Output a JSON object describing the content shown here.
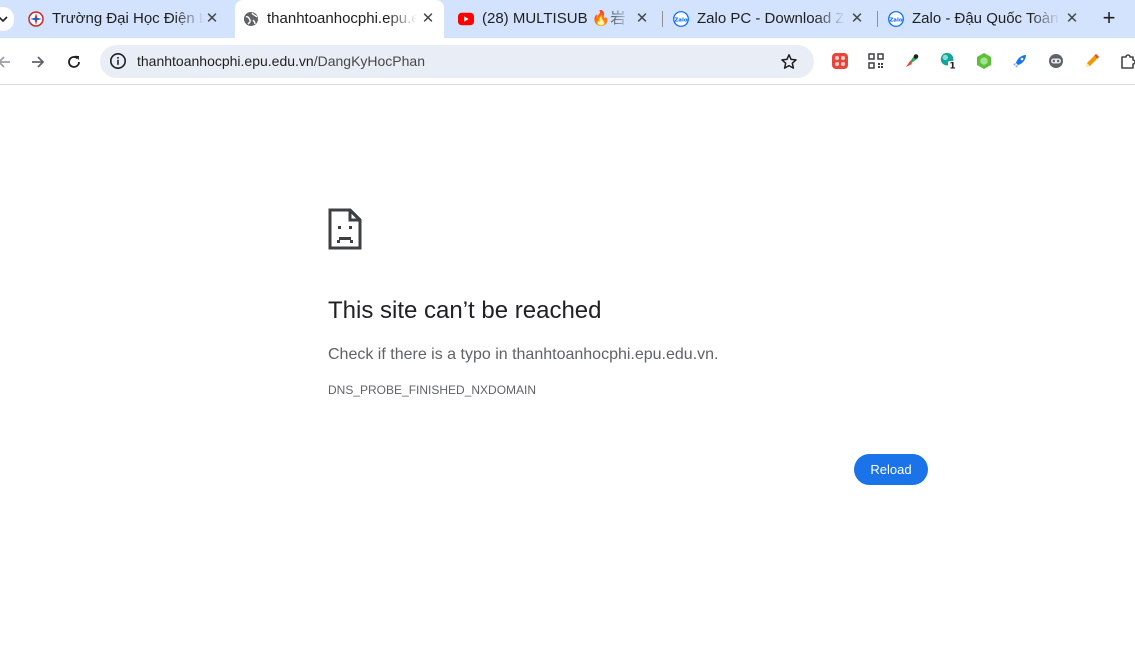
{
  "tabs": [
    {
      "title": "Trường Đại Học Điện Lực",
      "favicon": "epu-logo-icon",
      "active": false
    },
    {
      "title": "thanhtoanhocphi.epu.edu.vn",
      "favicon": "globe-icon",
      "active": true
    },
    {
      "title": "(28) MULTISUB 🔥岩",
      "favicon": "youtube-icon",
      "active": false
    },
    {
      "title": "Zalo PC - Download Zalo",
      "favicon": "zalo-icon",
      "active": false
    },
    {
      "title": "Zalo - Đậu Quốc Toàn",
      "favicon": "zalo-icon",
      "active": false
    }
  ],
  "toolbar": {
    "url_host": "thanhtoanhocphi.epu.edu.vn",
    "url_path": "/DangKyHocPhan",
    "extensions": [
      {
        "name": "gift-extension-icon",
        "color": "#e8453c"
      },
      {
        "name": "qr-code-extension-icon",
        "color": "#3c4043"
      },
      {
        "name": "color-picker-extension-icon",
        "color": "#34a853"
      },
      {
        "name": "badge-extension-icon",
        "color": "#1aa39a",
        "badge": "1"
      },
      {
        "name": "hexagon-extension-icon",
        "color": "#5bbf3a"
      },
      {
        "name": "rocket-extension-icon",
        "color": "#1a73e8"
      },
      {
        "name": "robot-extension-icon",
        "color": "#5f6368"
      },
      {
        "name": "pencil-extension-icon",
        "color": "#f29900"
      },
      {
        "name": "puzzle-extensions-icon",
        "color": "#444746"
      }
    ]
  },
  "error": {
    "title": "This site can’t be reached",
    "subtitle": "Check if there is a typo in thanhtoanhocphi.epu.edu.vn.",
    "code": "DNS_PROBE_FINISHED_NXDOMAIN",
    "reload_label": "Reload"
  },
  "colors": {
    "tabstrip_bg": "#d3e3fd",
    "omnibox_bg": "#e9eef6",
    "accent": "#1a73e8"
  }
}
